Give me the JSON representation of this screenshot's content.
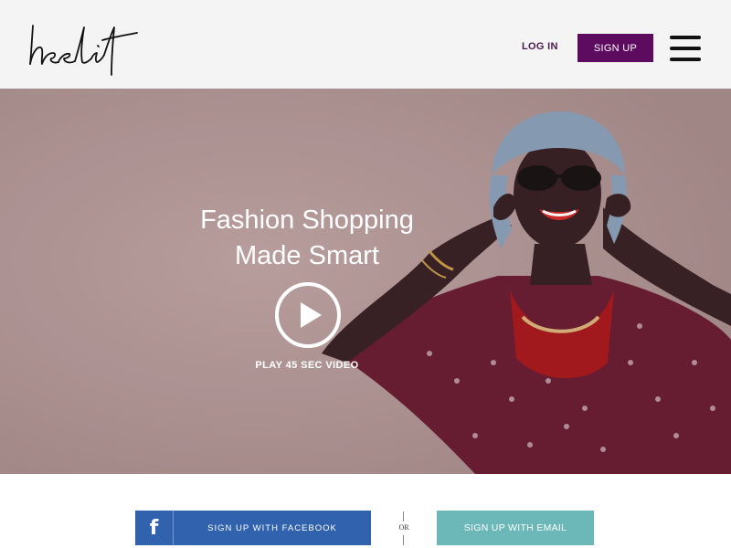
{
  "header": {
    "logo_text": "heelit",
    "login_label": "LOG IN",
    "signup_label": "SIGN UP",
    "menu_icon": "hamburger-menu-icon"
  },
  "hero": {
    "headline_line1": "Fashion Shopping",
    "headline_line2": "Made Smart",
    "play_icon": "play-icon",
    "play_label": "PLAY 45 SEC VIDEO"
  },
  "signup_bar": {
    "facebook_icon": "facebook-icon",
    "facebook_icon_glyph": "f",
    "facebook_label": "SIGN UP WITH FACEBOOK",
    "or_label": "OR",
    "email_label": "SIGN UP WITH EMAIL"
  },
  "colors": {
    "brand_purple": "#5c0b5e",
    "hero_background": "#b59999",
    "facebook_blue": "#3162ad",
    "email_teal": "#6cb7b8",
    "header_background": "#f4f4f4"
  }
}
